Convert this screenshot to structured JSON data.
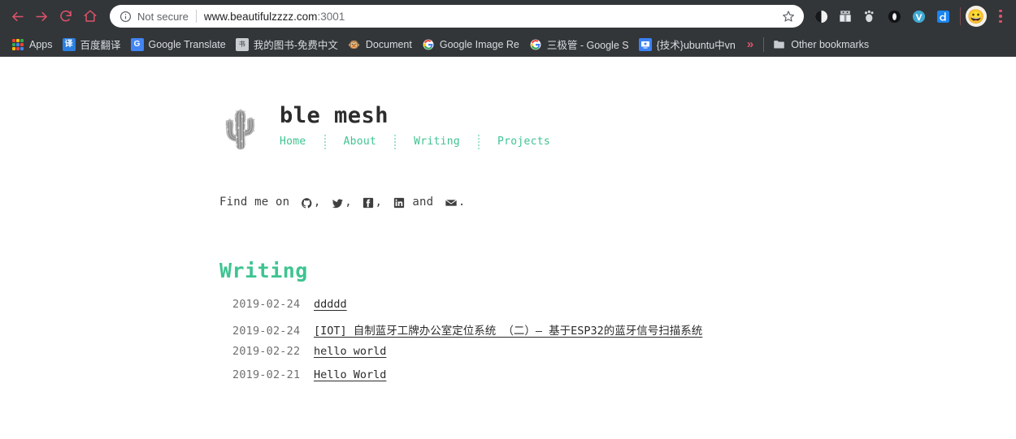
{
  "browser": {
    "nav": {
      "back_label": "Back",
      "forward_label": "Forward",
      "reload_label": "Reload",
      "home_label": "Home"
    },
    "omnibox": {
      "security_label": "Not secure",
      "url": "www.beautifulzzzz.com",
      "port": ":3001",
      "bookmark_label": "Bookmark this page"
    },
    "extensions": [
      {
        "name": "dark-reader-extension-icon",
        "glyph": "◐"
      },
      {
        "name": "gift-extension-icon",
        "glyph": "🎁"
      },
      {
        "name": "gnome-extension-icon",
        "glyph": "🐾"
      },
      {
        "name": "opera-extension-icon",
        "glyph": "O"
      },
      {
        "name": "vimium-extension-icon",
        "glyph": "V"
      },
      {
        "name": "d-extension-icon",
        "glyph": "d"
      }
    ],
    "profile": {
      "avatar_glyph": "😀",
      "label": "Profile"
    },
    "menu_label": "Customize and control Google Chrome",
    "bookmarks": [
      {
        "label": "Apps",
        "icon": "apps-grid-icon",
        "glyph": "",
        "bg": ""
      },
      {
        "label": "百度翻译",
        "icon": "baidu-translate-icon",
        "glyph": "译",
        "bg": "#2b7fe0"
      },
      {
        "label": "Google Translate",
        "icon": "google-translate-icon",
        "glyph": "G",
        "bg": "#4285f4"
      },
      {
        "label": "我的图书-免费中文",
        "icon": "books-icon",
        "glyph": "书",
        "bg": "#b8b8b8"
      },
      {
        "label": "Document",
        "icon": "document-icon",
        "glyph": "🐵",
        "bg": "#6d5b4b"
      },
      {
        "label": "Google Image Re",
        "icon": "google-icon",
        "glyph": "G",
        "bg": "#ffffff"
      },
      {
        "label": "三极管 - Google S",
        "icon": "google-icon",
        "glyph": "G",
        "bg": "#ffffff"
      },
      {
        "label": "{技术}ubuntu中vn",
        "icon": "ubuntu-bookmark-icon",
        "glyph": "🖥",
        "bg": "#3b82f6"
      }
    ],
    "bookmarks_overflow": "»",
    "other_bookmarks_label": "Other bookmarks"
  },
  "site": {
    "logo_glyph": "🌵",
    "logo_name": "cactus-logo",
    "title": "ble mesh",
    "nav": [
      {
        "label": "Home"
      },
      {
        "label": "About"
      },
      {
        "label": "Writing"
      },
      {
        "label": "Projects"
      }
    ],
    "find_me": {
      "prefix": "Find me on ",
      "joiner": " and ",
      "suffix": ".",
      "comma": ", ",
      "socials": [
        {
          "name": "github-icon",
          "label": "GitHub"
        },
        {
          "name": "twitter-icon",
          "label": "Twitter"
        },
        {
          "name": "facebook-icon",
          "label": "Facebook"
        },
        {
          "name": "linkedin-icon",
          "label": "LinkedIn"
        },
        {
          "name": "email-icon",
          "label": "Email"
        }
      ]
    },
    "writing": {
      "heading": "Writing",
      "posts": [
        {
          "date": "2019-02-24",
          "title": "ddddd"
        },
        {
          "date": "2019-02-24",
          "title": "[IOT] 自制蓝牙工牌办公室定位系统 （二）— 基于ESP32的蓝牙信号扫描系统"
        },
        {
          "date": "2019-02-22",
          "title": "hello world"
        },
        {
          "date": "2019-02-21",
          "title": "Hello World"
        }
      ]
    }
  },
  "colors": {
    "accent_green": "#3ec491",
    "chrome_bg": "#323639",
    "nav_pink": "#e0526b"
  }
}
